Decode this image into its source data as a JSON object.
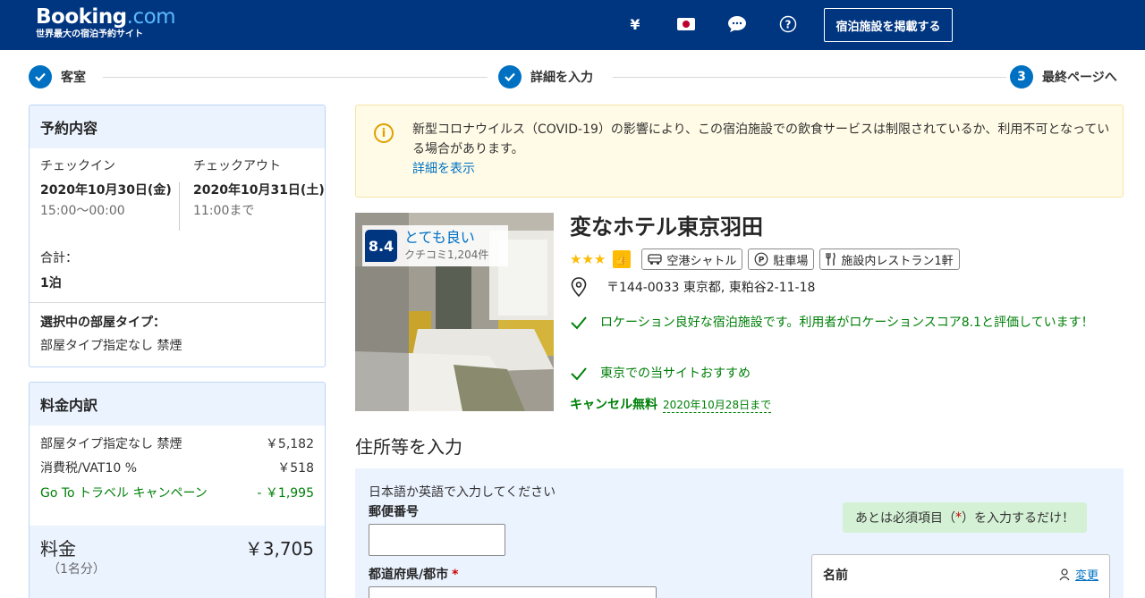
{
  "header": {
    "logo_main": "Booking",
    "logo_com": ".com",
    "logo_sub": "世界最大の宿泊予約サイト",
    "currency": "¥",
    "list_property_button": "宿泊施設を掲載する",
    "icons": [
      "yen-icon",
      "japan-flag-icon",
      "chat-icon",
      "help-icon"
    ]
  },
  "progress": {
    "steps": [
      {
        "label": "客室",
        "state": "done"
      },
      {
        "label": "詳細を入力",
        "state": "done"
      },
      {
        "label": "最終ページへ",
        "number": "3",
        "state": "current"
      }
    ]
  },
  "booking_summary": {
    "title": "予約内容",
    "checkin_label": "チェックイン",
    "checkin_date": "2020年10月30日(金)",
    "checkin_time": "15:00～00:00",
    "checkout_label": "チェックアウト",
    "checkout_date": "2020年10月31日(土)",
    "checkout_time": "11:00まで",
    "total_label": "合計：",
    "total_nights": "1泊",
    "selected_room_title": "選択中の部屋タイプ：",
    "selected_room": "部屋タイプ指定なし 禁煙"
  },
  "price_breakdown": {
    "title": "料金内訳",
    "rows": [
      {
        "label": "部屋タイプ指定なし 禁煙",
        "value": "￥5,182"
      },
      {
        "label": "消費税/VAT10 %",
        "value": "￥518"
      },
      {
        "label": "Go To トラベル キャンペーン",
        "value": "- ￥1,995"
      }
    ],
    "total_label": "料金",
    "total_value": "￥3,705",
    "total_sub": "（1名分）"
  },
  "alert": {
    "text": "新型コロナウイルス（COVID-19）の影響により、この宿泊施設での飲食サービスは制限されているか、利用不可となっている場合があります。",
    "link": "詳細を表示"
  },
  "hotel": {
    "name": "変なホテル東京羽田",
    "score": "8.4",
    "score_word": "とても良い",
    "review_count": "クチコミ1,204件",
    "stars": 3,
    "amenities": [
      "空港シャトル",
      "駐車場",
      "施設内レストラン1軒"
    ],
    "address": "〒144-0033 東京都, 東粕谷2-11-18",
    "highlights": [
      "ロケーション良好な宿泊施設です。利用者がロケーションスコア8.1と評価しています！",
      "東京での当サイトおすすめ"
    ],
    "cancel_free": "キャンセル無料",
    "cancel_date": "2020年10月28日まで"
  },
  "form": {
    "section_title": "住所等を入力",
    "note": "日本語か英語で入力してください",
    "postal_label": "郵便番号",
    "prefecture_label": "都道府県/都市",
    "required_mark": "*",
    "required_note_pre": "あとは必須項目（",
    "required_note_post": "）を入力するだけ！",
    "guest_name_label": "名前",
    "guest_edit_link": "変更"
  },
  "colors": {
    "brand_blue": "#003580",
    "link_blue": "#0071c2",
    "green": "#008009",
    "light_blue_bg": "#ebf3ff",
    "alert_bg": "#fffbe6",
    "star_yellow": "#febb02"
  }
}
